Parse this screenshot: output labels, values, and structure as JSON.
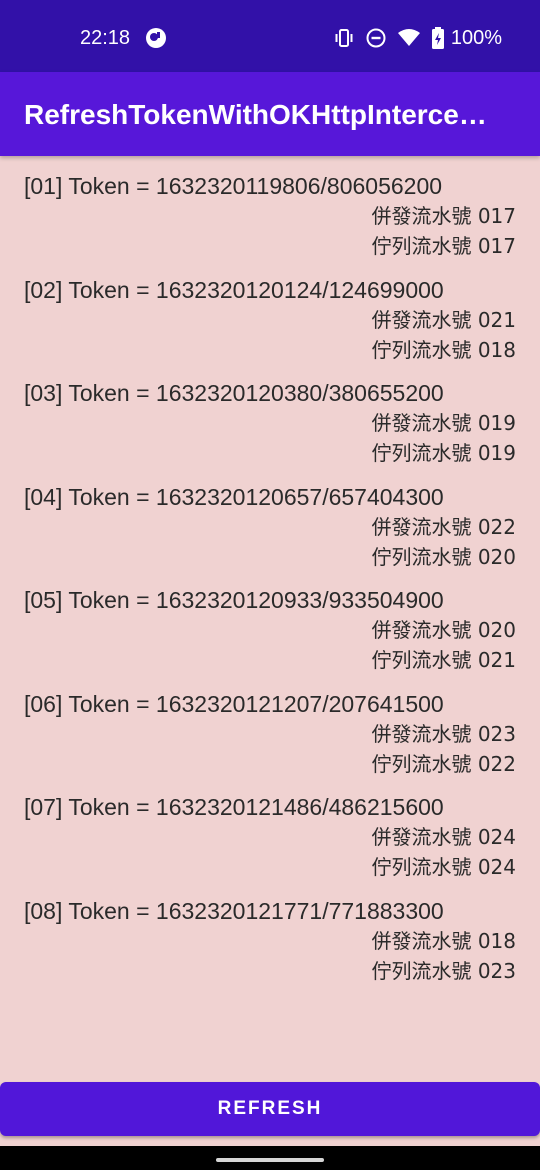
{
  "status_bar": {
    "time": "22:18",
    "battery": "100%",
    "icons": [
      "app-notification-icon",
      "vibrate-icon",
      "do-not-disturb-icon",
      "wifi-icon",
      "battery-icon"
    ]
  },
  "app_bar": {
    "title": "RefreshTokenWithOKHttpIntercepto"
  },
  "entries": [
    {
      "token": "[01] Token = 1632320119806/806056200",
      "concurrent": "併發流水號 017",
      "queue": "佇列流水號 017"
    },
    {
      "token": "[02] Token = 1632320120124/124699000",
      "concurrent": "併發流水號 021",
      "queue": "佇列流水號 018"
    },
    {
      "token": "[03] Token = 1632320120380/380655200",
      "concurrent": "併發流水號 019",
      "queue": "佇列流水號 019"
    },
    {
      "token": "[04] Token = 1632320120657/657404300",
      "concurrent": "併發流水號 022",
      "queue": "佇列流水號 020"
    },
    {
      "token": "[05] Token = 1632320120933/933504900",
      "concurrent": "併發流水號 020",
      "queue": "佇列流水號 021"
    },
    {
      "token": "[06] Token = 1632320121207/207641500",
      "concurrent": "併發流水號 023",
      "queue": "佇列流水號 022"
    },
    {
      "token": "[07] Token = 1632320121486/486215600",
      "concurrent": "併發流水號 024",
      "queue": "佇列流水號 024"
    },
    {
      "token": "[08] Token = 1632320121771/771883300",
      "concurrent": "併發流水號 018",
      "queue": "佇列流水號 023"
    }
  ],
  "refresh_button": {
    "label": "REFRESH"
  },
  "colors": {
    "status_bar": "#3211a8",
    "app_bar": "#5717d9",
    "background": "#f0d2d1",
    "button": "#5117d9"
  }
}
